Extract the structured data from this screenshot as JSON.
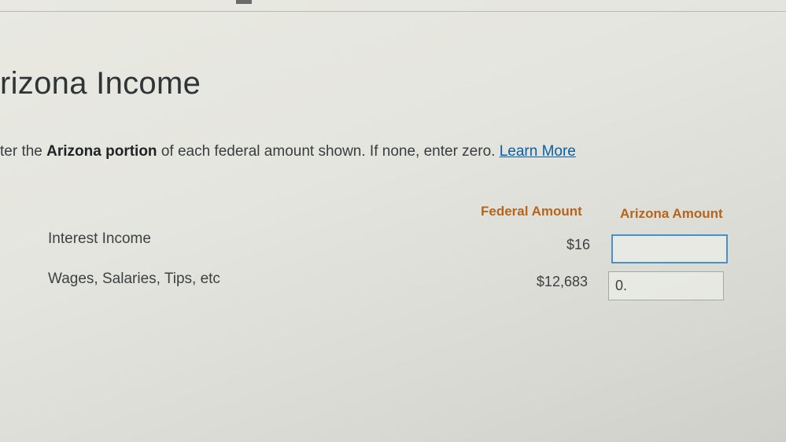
{
  "page": {
    "title": "rizona Income",
    "instruction": {
      "prefix": "ter the ",
      "bold": "Arizona portion",
      "suffix": " of each federal amount shown. If none, enter zero. ",
      "link": "Learn More"
    }
  },
  "table": {
    "columns": {
      "federal": "Federal Amount",
      "arizona": "Arizona Amount"
    },
    "rows": [
      {
        "label": "Interest Income",
        "federal_amount": "$16",
        "arizona_value": ""
      },
      {
        "label": "Wages, Salaries, Tips, etc",
        "federal_amount": "$12,683",
        "arizona_value": "0."
      }
    ]
  },
  "colors": {
    "column_header": "#b5651d",
    "link": "#0a5ea8",
    "focus_border": "#4a90c8"
  }
}
